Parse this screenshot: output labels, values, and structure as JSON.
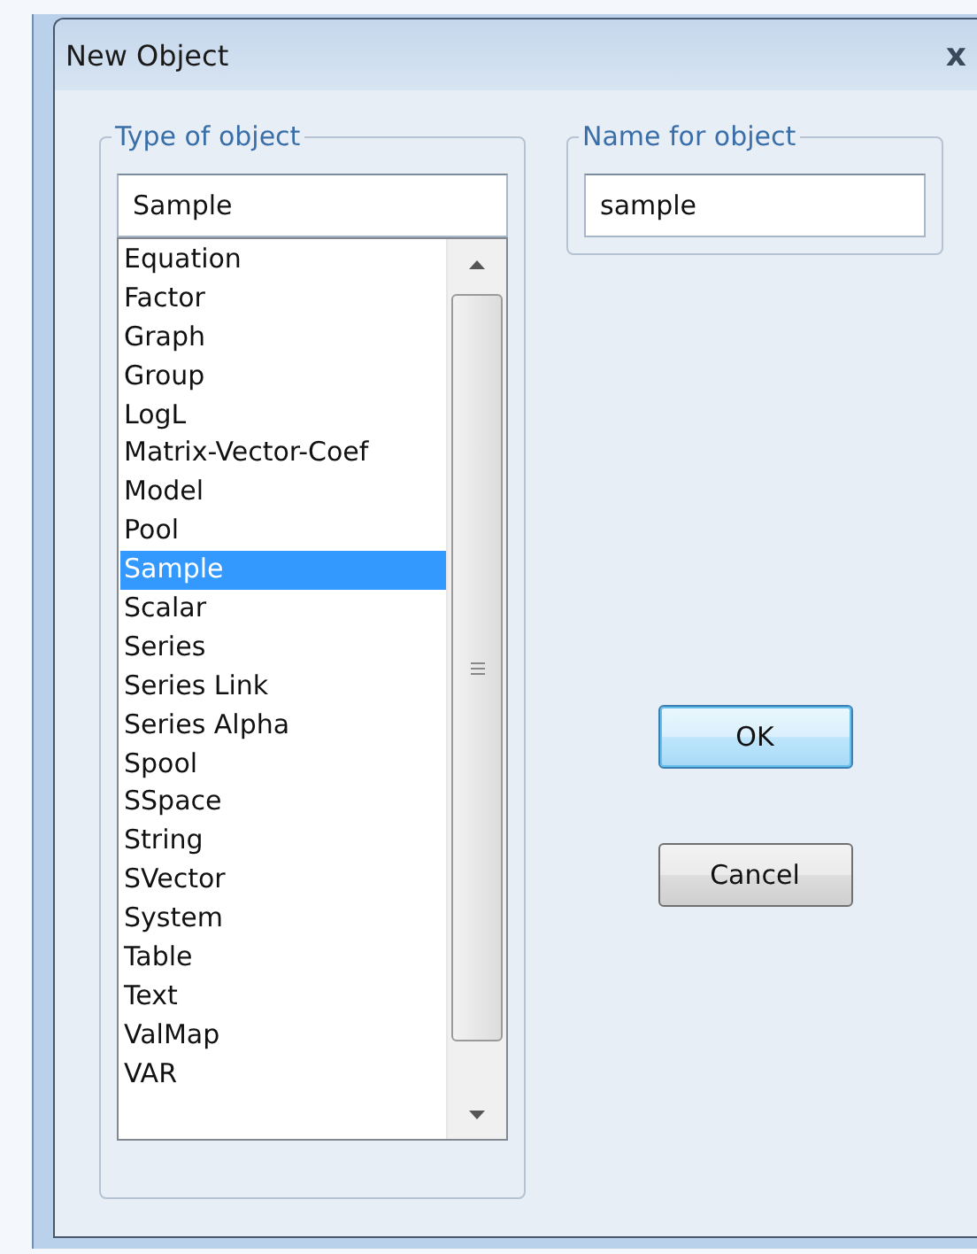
{
  "window": {
    "title": "New Object",
    "close": "x"
  },
  "type_group": {
    "label": "Type of object",
    "value": "Sample",
    "items": [
      {
        "label": "Equation",
        "selected": false
      },
      {
        "label": "Factor",
        "selected": false
      },
      {
        "label": "Graph",
        "selected": false
      },
      {
        "label": "Group",
        "selected": false
      },
      {
        "label": "LogL",
        "selected": false
      },
      {
        "label": "Matrix-Vector-Coef",
        "selected": false
      },
      {
        "label": "Model",
        "selected": false
      },
      {
        "label": "Pool",
        "selected": false
      },
      {
        "label": "Sample",
        "selected": true
      },
      {
        "label": "Scalar",
        "selected": false
      },
      {
        "label": "Series",
        "selected": false
      },
      {
        "label": "Series Link",
        "selected": false
      },
      {
        "label": "Series Alpha",
        "selected": false
      },
      {
        "label": "Spool",
        "selected": false
      },
      {
        "label": "SSpace",
        "selected": false
      },
      {
        "label": "String",
        "selected": false
      },
      {
        "label": "SVector",
        "selected": false
      },
      {
        "label": "System",
        "selected": false
      },
      {
        "label": "Table",
        "selected": false
      },
      {
        "label": "Text",
        "selected": false
      },
      {
        "label": "ValMap",
        "selected": false
      },
      {
        "label": "VAR",
        "selected": false
      }
    ]
  },
  "name_group": {
    "label": "Name for object",
    "value": "sample"
  },
  "buttons": [
    {
      "label": "OK",
      "default": true
    },
    {
      "label": "Cancel",
      "default": false
    }
  ]
}
